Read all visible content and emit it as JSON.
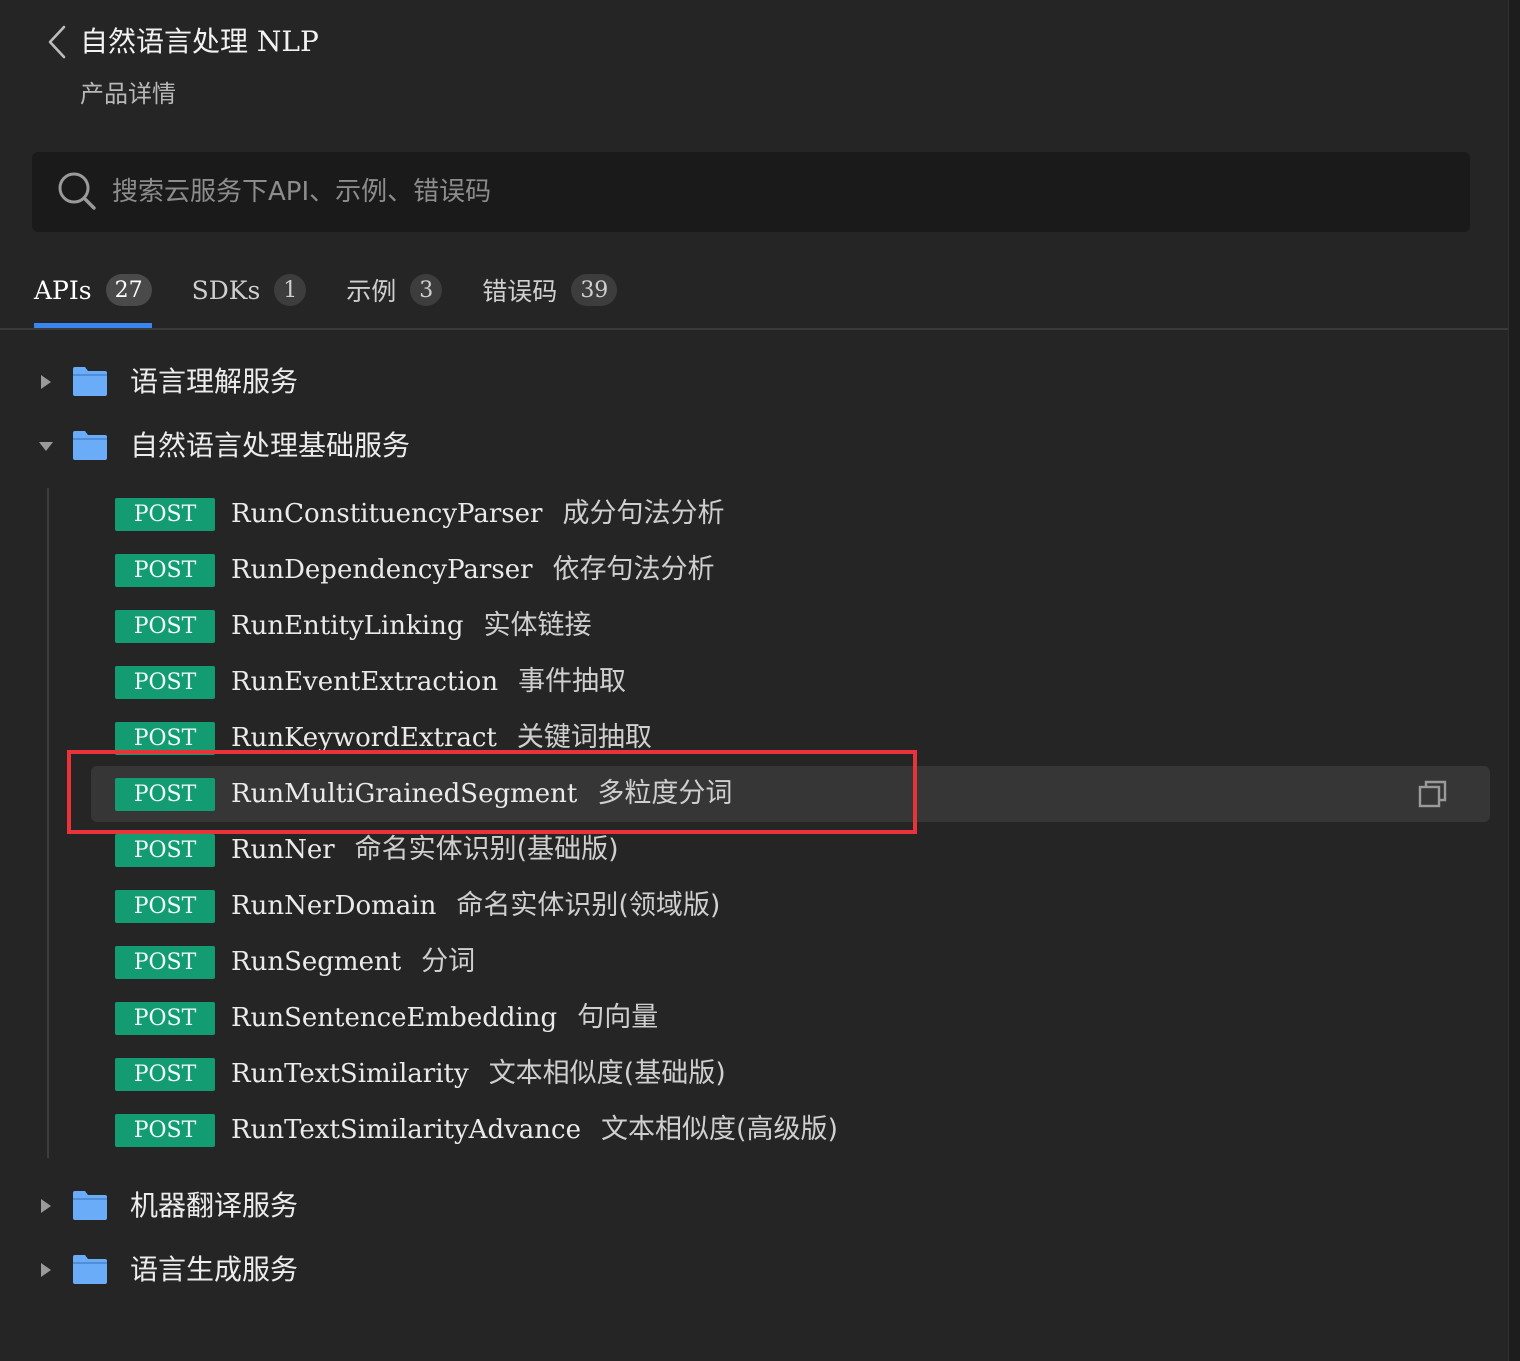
{
  "header": {
    "title": "自然语言处理 NLP",
    "subtitle": "产品详情"
  },
  "search": {
    "placeholder": "搜索云服务下API、示例、错误码"
  },
  "tabs": [
    {
      "label": "APIs",
      "count": "27",
      "active": true
    },
    {
      "label": "SDKs",
      "count": "1",
      "active": false
    },
    {
      "label": "示例",
      "count": "3",
      "active": false
    },
    {
      "label": "错误码",
      "count": "39",
      "active": false
    }
  ],
  "tree": {
    "groups": [
      {
        "label": "语言理解服务",
        "expanded": false
      },
      {
        "label": "自然语言处理基础服务",
        "expanded": true
      },
      {
        "label": "机器翻译服务",
        "expanded": false
      },
      {
        "label": "语言生成服务",
        "expanded": false
      }
    ],
    "apis": [
      {
        "method": "POST",
        "name": "RunConstituencyParser",
        "desc": "成分句法分析"
      },
      {
        "method": "POST",
        "name": "RunDependencyParser",
        "desc": "依存句法分析"
      },
      {
        "method": "POST",
        "name": "RunEntityLinking",
        "desc": "实体链接"
      },
      {
        "method": "POST",
        "name": "RunEventExtraction",
        "desc": "事件抽取"
      },
      {
        "method": "POST",
        "name": "RunKeywordExtract",
        "desc": "关键词抽取"
      },
      {
        "method": "POST",
        "name": "RunMultiGrainedSegment",
        "desc": "多粒度分词"
      },
      {
        "method": "POST",
        "name": "RunNer",
        "desc": "命名实体识别(基础版)"
      },
      {
        "method": "POST",
        "name": "RunNerDomain",
        "desc": "命名实体识别(领域版)"
      },
      {
        "method": "POST",
        "name": "RunSegment",
        "desc": "分词"
      },
      {
        "method": "POST",
        "name": "RunSentenceEmbedding",
        "desc": "句向量"
      },
      {
        "method": "POST",
        "name": "RunTextSimilarity",
        "desc": "文本相似度(基础版)"
      },
      {
        "method": "POST",
        "name": "RunTextSimilarityAdvance",
        "desc": "文本相似度(高级版)"
      }
    ]
  },
  "colors": {
    "background": "#252525",
    "search_bg": "#1a1a1a",
    "tab_accent": "#3a86f0",
    "post_badge": "#139c71",
    "folder": "#6aacf7",
    "highlight_border": "#e8333a",
    "hover_row": "#363636"
  },
  "icons": {
    "back": "chevron-left-icon",
    "search": "search-icon",
    "folder": "folder-icon",
    "caret_collapsed": "caret-right-icon",
    "caret_expanded": "caret-down-icon",
    "copy": "copy-icon"
  }
}
